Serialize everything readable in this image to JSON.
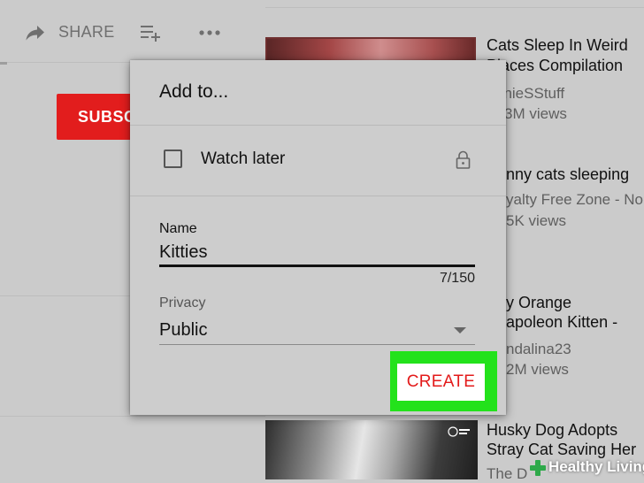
{
  "toolbar": {
    "share_label": "SHARE",
    "icons": [
      "share-arrow-icon",
      "add-to-playlist-icon",
      "more-horizontal-icon"
    ]
  },
  "channel": {
    "subscribe_label": "SUBSC"
  },
  "dialog": {
    "title": "Add to...",
    "watch_later_label": "Watch later",
    "watch_later_checked": false,
    "name_label": "Name",
    "name_value": "Kitties",
    "char_counter": "7/150",
    "privacy_label": "Privacy",
    "privacy_value": "Public",
    "create_label": "CREATE",
    "highlight_color": "#23e21b",
    "create_text_color": "#e31b1b"
  },
  "related_videos": [
    {
      "title_line1": "Cats Sleep In Weird",
      "title_line2": "Places Compilation",
      "channel": "nnieSStuff",
      "views": "3M views"
    },
    {
      "title_line1": "nny cats sleeping",
      "channel": "yalty Free Zone - No",
      "views": "5K views"
    },
    {
      "title_line1": "y Orange",
      "title_line2": "apoleon Kitten -",
      "channel": "ndalina23",
      "views": "2M views"
    },
    {
      "title_line1": "Husky Dog Adopts",
      "title_line2": "Stray Cat Saving Her",
      "channel": "The D"
    }
  ],
  "watermark": {
    "text": "Healthy Living",
    "logo": "green-plus-icon"
  },
  "colors": {
    "subscribe_red": "#e21d1d",
    "background": "#cbcbcb"
  }
}
